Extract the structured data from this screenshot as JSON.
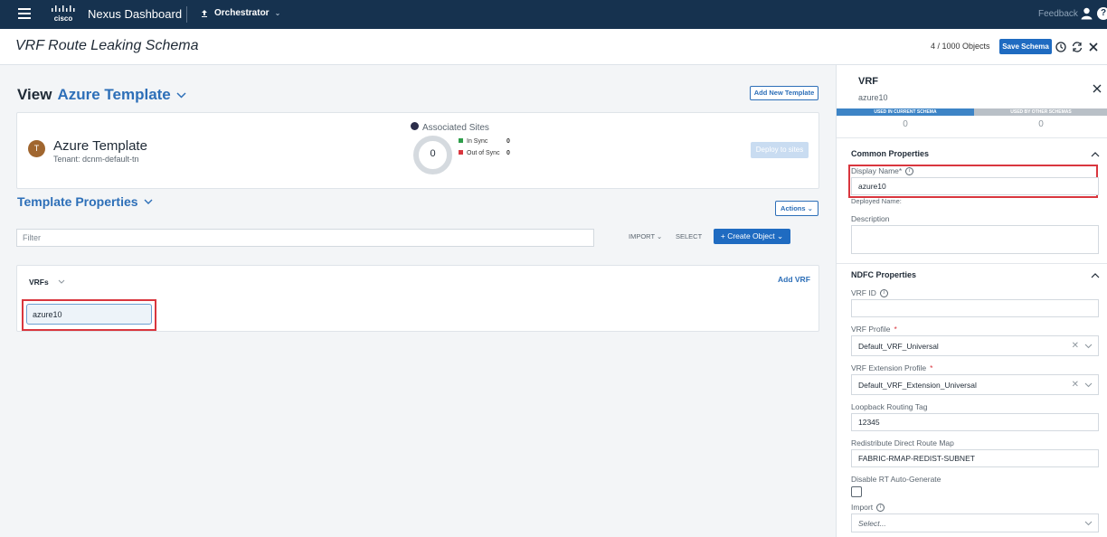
{
  "topbar": {
    "brand": "Nexus Dashboard",
    "cisco_logo_text": "cisco",
    "service": "Orchestrator",
    "feedback": "Feedback",
    "help": "?"
  },
  "titlebar": {
    "title": "VRF Route Leaking Schema",
    "object_count": "4 / 1000 Objects",
    "save_label": "Save Schema"
  },
  "view": {
    "label": "View",
    "template_name": "Azure Template",
    "add_template_label": "Add New Template"
  },
  "template_card": {
    "avatar_letter": "T",
    "name": "Azure Template",
    "tenant": "Tenant: dcnm-default-tn",
    "associated_sites_title": "Associated Sites",
    "sites_count": "0",
    "in_sync_label": "In Sync",
    "in_sync_value": "0",
    "out_of_sync_label": "Out of Sync",
    "out_of_sync_value": "0",
    "deploy_label": "Deploy to sites"
  },
  "template_properties": {
    "title": "Template Properties",
    "actions_label": "Actions",
    "filter_placeholder": "Filter",
    "import_label": "IMPORT",
    "select_label": "SELECT",
    "create_label": "Create Object"
  },
  "vrfs": {
    "title": "VRFs",
    "add_label": "Add VRF",
    "items": [
      "azure10"
    ]
  },
  "panel": {
    "title": "VRF",
    "subtitle": "azure10",
    "used_in_current": "USED IN CURRENT SCHEMA",
    "used_by_other": "USED BY OTHER SCHEMAS",
    "used_in_current_count": "0",
    "used_by_other_count": "0",
    "common_header": "Common Properties",
    "display_name_label": "Display Name*",
    "display_name_value": "azure10",
    "deployed_name_label": "Deployed Name:",
    "description_label": "Description",
    "description_value": "",
    "ndfc_header": "NDFC Properties",
    "vrf_id_label": "VRF ID",
    "vrf_id_value": "",
    "vrf_profile_label": "VRF Profile",
    "vrf_profile_value": "Default_VRF_Universal",
    "vrf_ext_profile_label": "VRF Extension Profile",
    "vrf_ext_profile_value": "Default_VRF_Extension_Universal",
    "loopback_label": "Loopback Routing Tag",
    "loopback_value": "12345",
    "redistribute_label": "Redistribute Direct Route Map",
    "redistribute_value": "FABRIC-RMAP-REDIST-SUBNET",
    "disable_rt_label": "Disable RT Auto-Generate",
    "import_label": "Import",
    "import_placeholder": "Select...",
    "required_mark": "*"
  },
  "colors": {
    "topbar": "#16324f",
    "accent": "#2d6fb8",
    "primary_button": "#1f6bc1",
    "highlight": "#d9363e",
    "in_sync": "#2e9e4a",
    "out_of_sync": "#d9363e"
  }
}
